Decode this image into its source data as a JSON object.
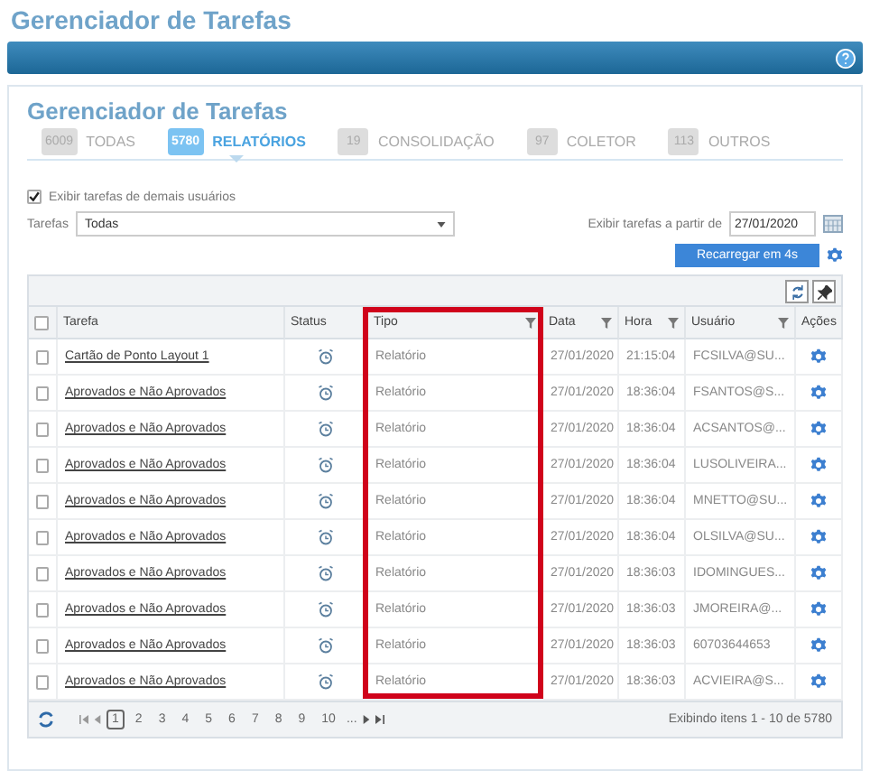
{
  "app_title": "Gerenciador de Tarefas",
  "panel": {
    "title": "Gerenciador de Tarefas",
    "tabs": [
      {
        "count": "6009",
        "label": "TODAS",
        "selected": false
      },
      {
        "count": "5780",
        "label": "RELATÓRIOS",
        "selected": true
      },
      {
        "count": "19",
        "label": "CONSOLIDAÇÃO",
        "selected": false
      },
      {
        "count": "97",
        "label": "COLETOR",
        "selected": false
      },
      {
        "count": "113",
        "label": "OUTROS",
        "selected": false
      }
    ]
  },
  "show_others": {
    "label": "Exibir tarefas de demais usuários",
    "checked": true
  },
  "task_filter": {
    "label": "Tarefas",
    "value": "Todas"
  },
  "date_filter": {
    "label": "Exibir tarefas a partir de",
    "value": "27/01/2020"
  },
  "reload_button": "Recarregar em  4s",
  "table": {
    "select_all_checked": false,
    "columns": [
      {
        "label": "Tarefa",
        "filter": false,
        "highlighted": false
      },
      {
        "label": "Status",
        "filter": false,
        "highlighted": false
      },
      {
        "label": "Tipo",
        "filter": true,
        "highlighted": true
      },
      {
        "label": "Data",
        "filter": true,
        "highlighted": false
      },
      {
        "label": "Hora",
        "filter": true,
        "highlighted": false
      },
      {
        "label": "Usuário",
        "filter": true,
        "highlighted": false
      },
      {
        "label": "Ações",
        "filter": false,
        "highlighted": false
      }
    ],
    "rows": [
      {
        "checked": false,
        "task": "Cartão de Ponto Layout 1",
        "type": "Relatório",
        "date": "27/01/2020",
        "time": "21:15:04",
        "user": "FCSILVA@SU..."
      },
      {
        "checked": false,
        "task": "Aprovados e Não Aprovados",
        "type": "Relatório",
        "date": "27/01/2020",
        "time": "18:36:04",
        "user": "FSANTOS@S..."
      },
      {
        "checked": false,
        "task": "Aprovados e Não Aprovados",
        "type": "Relatório",
        "date": "27/01/2020",
        "time": "18:36:04",
        "user": "ACSANTOS@..."
      },
      {
        "checked": false,
        "task": "Aprovados e Não Aprovados",
        "type": "Relatório",
        "date": "27/01/2020",
        "time": "18:36:04",
        "user": "LUSOLIVEIRA..."
      },
      {
        "checked": false,
        "task": "Aprovados e Não Aprovados",
        "type": "Relatório",
        "date": "27/01/2020",
        "time": "18:36:04",
        "user": "MNETTO@SU..."
      },
      {
        "checked": false,
        "task": "Aprovados e Não Aprovados",
        "type": "Relatório",
        "date": "27/01/2020",
        "time": "18:36:04",
        "user": "OLSILVA@SU..."
      },
      {
        "checked": false,
        "task": "Aprovados e Não Aprovados",
        "type": "Relatório",
        "date": "27/01/2020",
        "time": "18:36:03",
        "user": "IDOMINGUES..."
      },
      {
        "checked": false,
        "task": "Aprovados e Não Aprovados",
        "type": "Relatório",
        "date": "27/01/2020",
        "time": "18:36:03",
        "user": "JMOREIRA@..."
      },
      {
        "checked": false,
        "task": "Aprovados e Não Aprovados",
        "type": "Relatório",
        "date": "27/01/2020",
        "time": "18:36:03",
        "user": "60703644653"
      },
      {
        "checked": false,
        "task": "Aprovados e Não Aprovados",
        "type": "Relatório",
        "date": "27/01/2020",
        "time": "18:36:03",
        "user": "ACVIEIRA@S..."
      }
    ]
  },
  "pager": {
    "pages": [
      {
        "label": "1",
        "selected": true
      },
      {
        "label": "2",
        "selected": false
      },
      {
        "label": "3",
        "selected": false
      },
      {
        "label": "4",
        "selected": false
      },
      {
        "label": "5",
        "selected": false
      },
      {
        "label": "6",
        "selected": false
      },
      {
        "label": "7",
        "selected": false
      },
      {
        "label": "8",
        "selected": false
      },
      {
        "label": "9",
        "selected": false
      },
      {
        "label": "10",
        "selected": false
      }
    ],
    "more": "...",
    "summary": "Exibindo itens 1 - 10 de 5780"
  }
}
